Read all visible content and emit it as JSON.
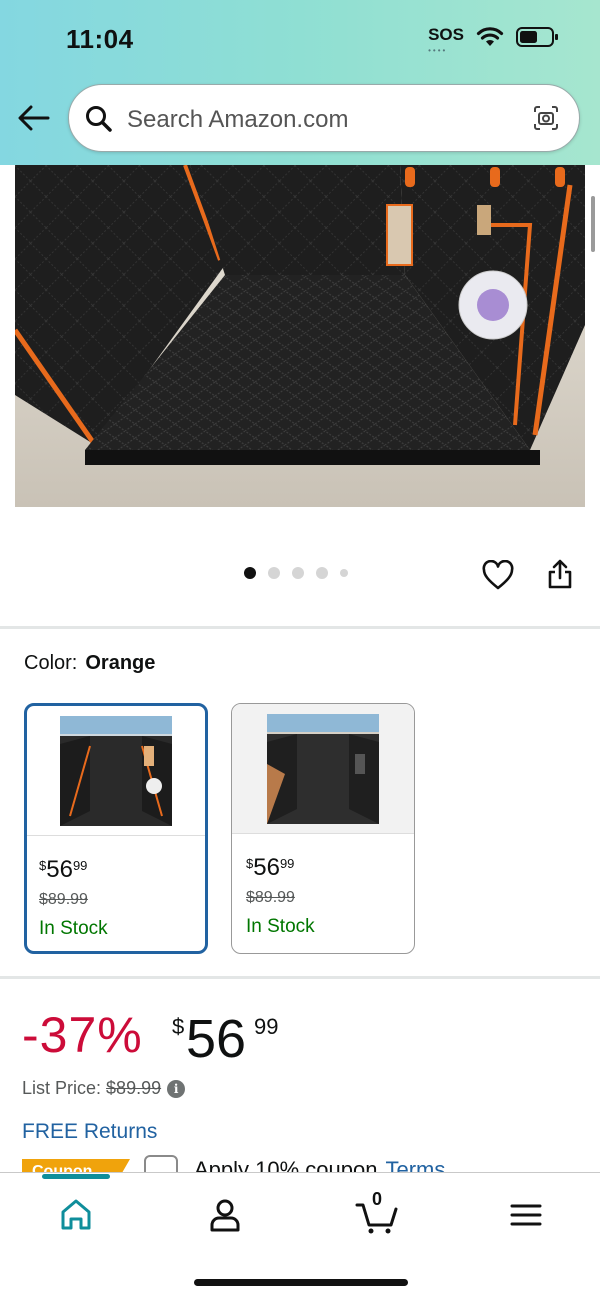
{
  "status_bar": {
    "time": "11:04",
    "sos": "SOS"
  },
  "search": {
    "placeholder": "Search Amazon.com"
  },
  "product_image": {
    "carousel_count": 5,
    "active_index": 0
  },
  "variant": {
    "label": "Color:",
    "selected": "Orange"
  },
  "swatches": [
    {
      "price_symbol": "$",
      "price_whole": "56",
      "price_fraction": "99",
      "list_price": "$89.99",
      "stock": "In Stock",
      "selected": true
    },
    {
      "price_symbol": "$",
      "price_whole": "56",
      "price_fraction": "99",
      "list_price": "$89.99",
      "stock": "In Stock",
      "selected": false
    }
  ],
  "pricing": {
    "discount": "-37%",
    "symbol": "$",
    "whole": "56",
    "fraction": "99",
    "list_price_label": "List Price:",
    "list_price": "$89.99",
    "free_returns": "FREE Returns"
  },
  "coupon": {
    "badge": "Coupon",
    "text": "Apply 10% coupon",
    "terms": "Terms"
  },
  "bottom_nav": {
    "cart_count": "0",
    "items": [
      "home-icon",
      "account-icon",
      "cart-icon",
      "menu-icon"
    ]
  },
  "colors": {
    "accent_teal": "#0f8e9b",
    "link_blue": "#2162a1",
    "discount_red": "#cc0c39",
    "stock_green": "#007600",
    "coupon_orange": "#f0a30c"
  }
}
